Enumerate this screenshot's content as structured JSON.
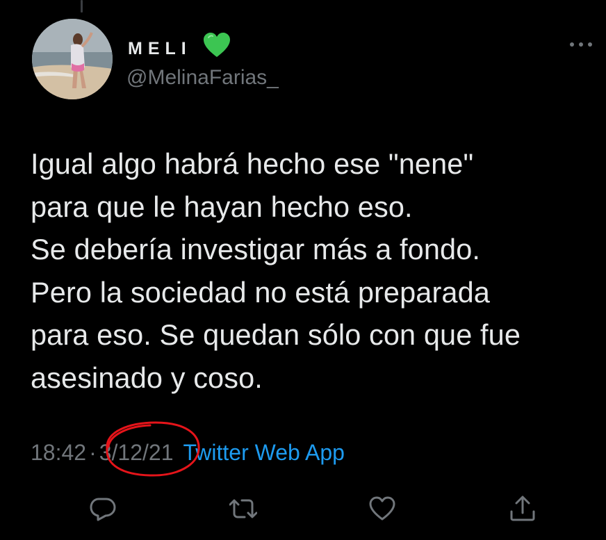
{
  "tweet": {
    "display_name": "MELI",
    "handle": "@MelinaFarias_",
    "text": "Igual algo habrá hecho ese \"nene\"\npara que le hayan hecho eso.\nSe debería investigar más a fondo.\nPero la sociedad no está preparada\npara eso. Se quedan sólo con que fue\nasesinado y coso.",
    "time": "18:42",
    "separator": "·",
    "date": "3/12/21",
    "source": "Twitter Web App"
  },
  "icons": {
    "verified_heart": "green-heart-icon",
    "more": "more-icon",
    "reply": "reply-icon",
    "retweet": "retweet-icon",
    "like": "like-icon",
    "share": "share-icon"
  },
  "colors": {
    "background": "#000000",
    "text": "#e7e9ea",
    "muted": "#71767b",
    "link": "#1d9bf0",
    "heart": "#3cc552",
    "annotation": "#e5141a"
  }
}
